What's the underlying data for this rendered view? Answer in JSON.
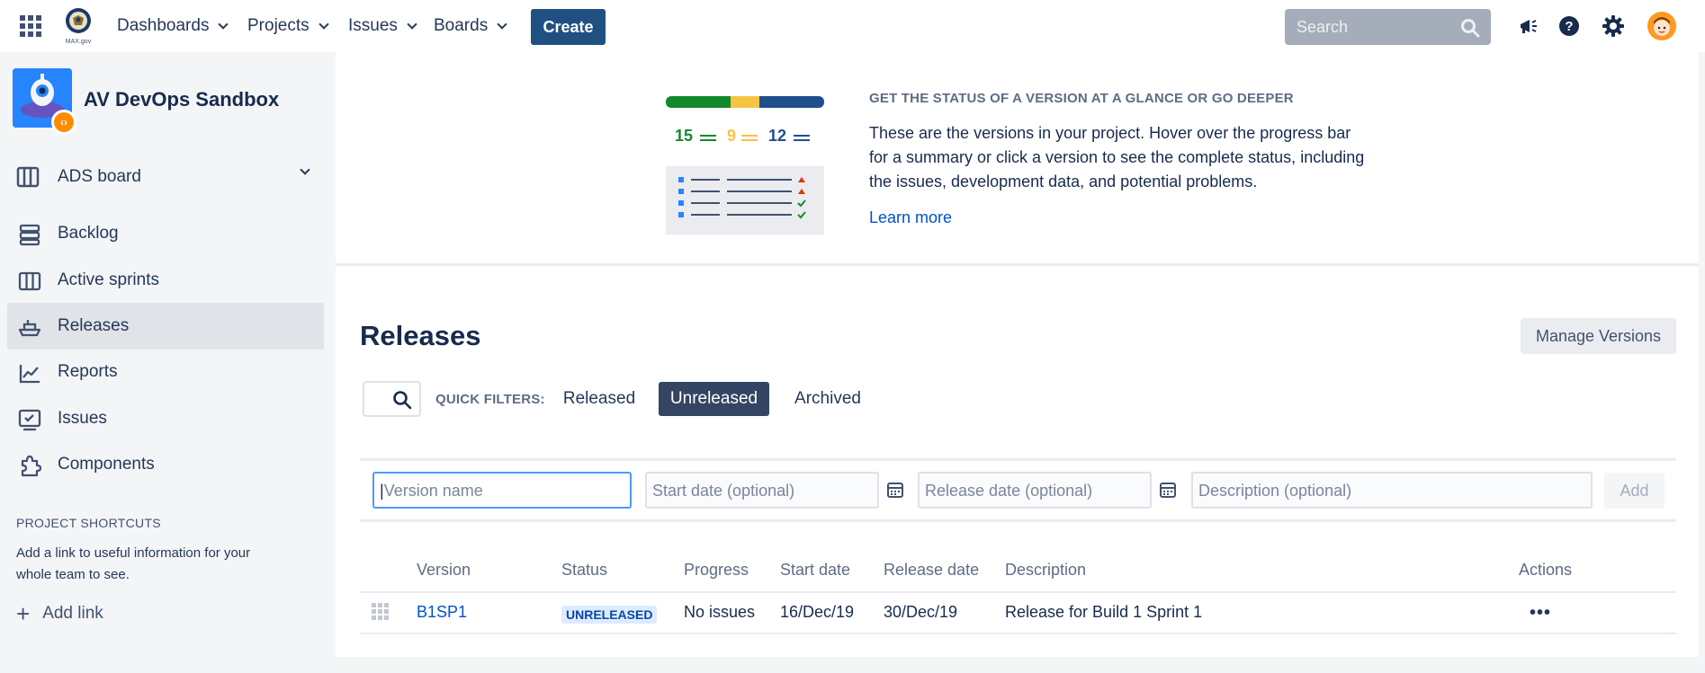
{
  "topnav": {
    "menus": [
      {
        "label": "Dashboards"
      },
      {
        "label": "Projects"
      },
      {
        "label": "Issues"
      },
      {
        "label": "Boards"
      }
    ],
    "create_label": "Create",
    "search_placeholder": "Search",
    "logo_text": "MAX.gov"
  },
  "sidebar": {
    "project_name": "AV DevOps Sandbox",
    "board_label": "ADS board",
    "items": [
      {
        "label": "Backlog",
        "icon": "backlog-icon"
      },
      {
        "label": "Active sprints",
        "icon": "board-columns-icon"
      },
      {
        "label": "Releases",
        "icon": "ship-icon",
        "active": true
      },
      {
        "label": "Reports",
        "icon": "chart-line-icon"
      },
      {
        "label": "Issues",
        "icon": "issues-icon"
      },
      {
        "label": "Components",
        "icon": "puzzle-icon"
      }
    ],
    "shortcuts_title": "PROJECT SHORTCUTS",
    "shortcuts_text": "Add a link to useful information for your whole team to see.",
    "add_link_label": "Add link"
  },
  "info": {
    "counts": {
      "done": "15",
      "in_progress": "9",
      "todo": "12"
    },
    "title": "GET THE STATUS OF A VERSION AT A GLANCE OR GO DEEPER",
    "text": "These are the versions in your project. Hover over the progress bar for a summary or click a version to see the complete status, including the issues, development data, and potential problems.",
    "learn_more": "Learn more"
  },
  "releases": {
    "title": "Releases",
    "manage_label": "Manage Versions",
    "quick_filters_label": "QUICK FILTERS:",
    "filters": [
      {
        "label": "Released",
        "active": false
      },
      {
        "label": "Unreleased",
        "active": true
      },
      {
        "label": "Archived",
        "active": false
      }
    ]
  },
  "add_form": {
    "version_placeholder": "Version name",
    "start_placeholder": "Start date (optional)",
    "release_placeholder": "Release date (optional)",
    "description_placeholder": "Description (optional)",
    "add_label": "Add"
  },
  "table": {
    "headers": {
      "version": "Version",
      "status": "Status",
      "progress": "Progress",
      "start": "Start date",
      "release": "Release date",
      "description": "Description",
      "actions": "Actions"
    },
    "rows": [
      {
        "version": "B1SP1",
        "status": "UNRELEASED",
        "progress": "No issues",
        "start": "16/Dec/19",
        "release": "30/Dec/19",
        "description": "Release for Build 1 Sprint 1",
        "actions": "•••"
      }
    ]
  },
  "colors": {
    "primary": "#205081",
    "link": "#0052cc",
    "done": "#14892c",
    "in_progress": "#f6c342",
    "todo": "#1f4e8c"
  }
}
